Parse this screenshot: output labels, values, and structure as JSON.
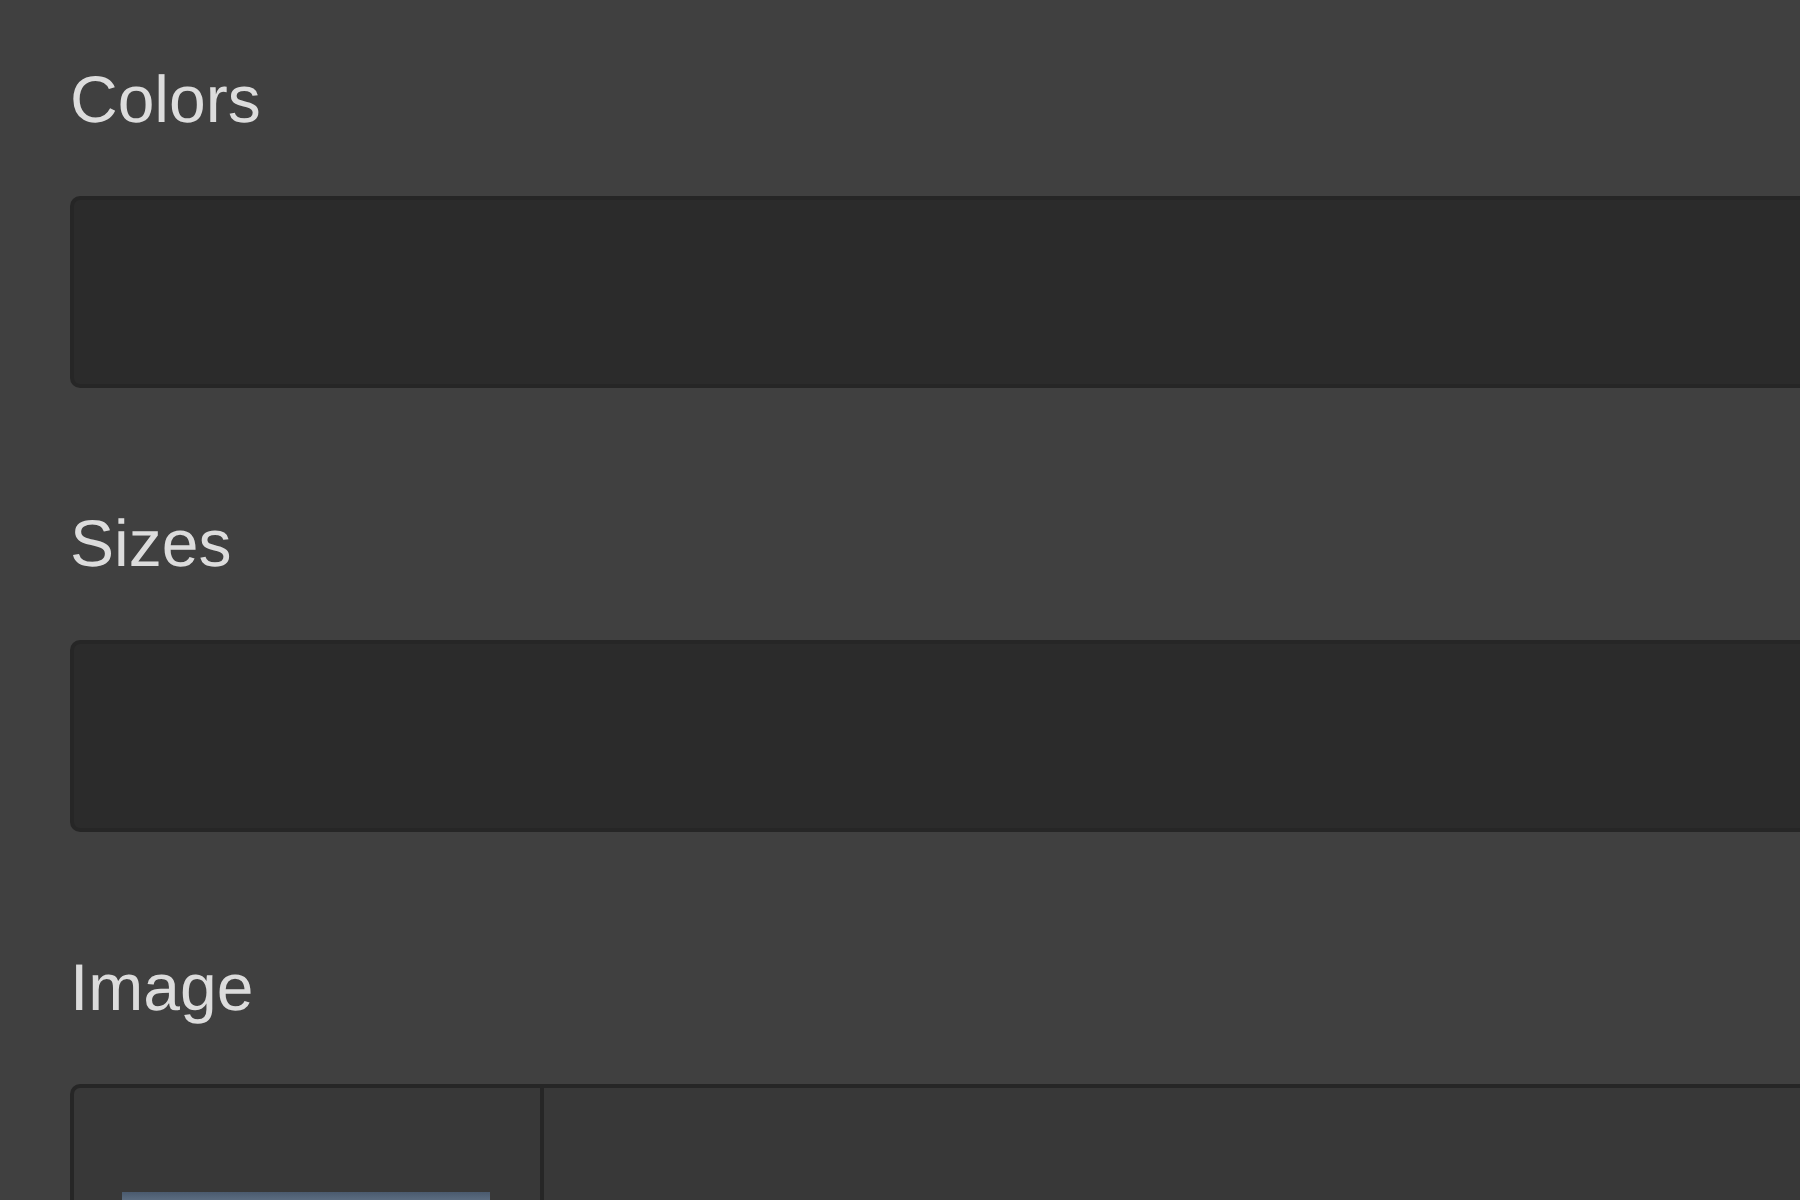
{
  "fields": [
    {
      "label": "Colors",
      "kind": "text"
    },
    {
      "label": "Sizes",
      "kind": "text"
    },
    {
      "label": "Image",
      "kind": "image"
    }
  ]
}
